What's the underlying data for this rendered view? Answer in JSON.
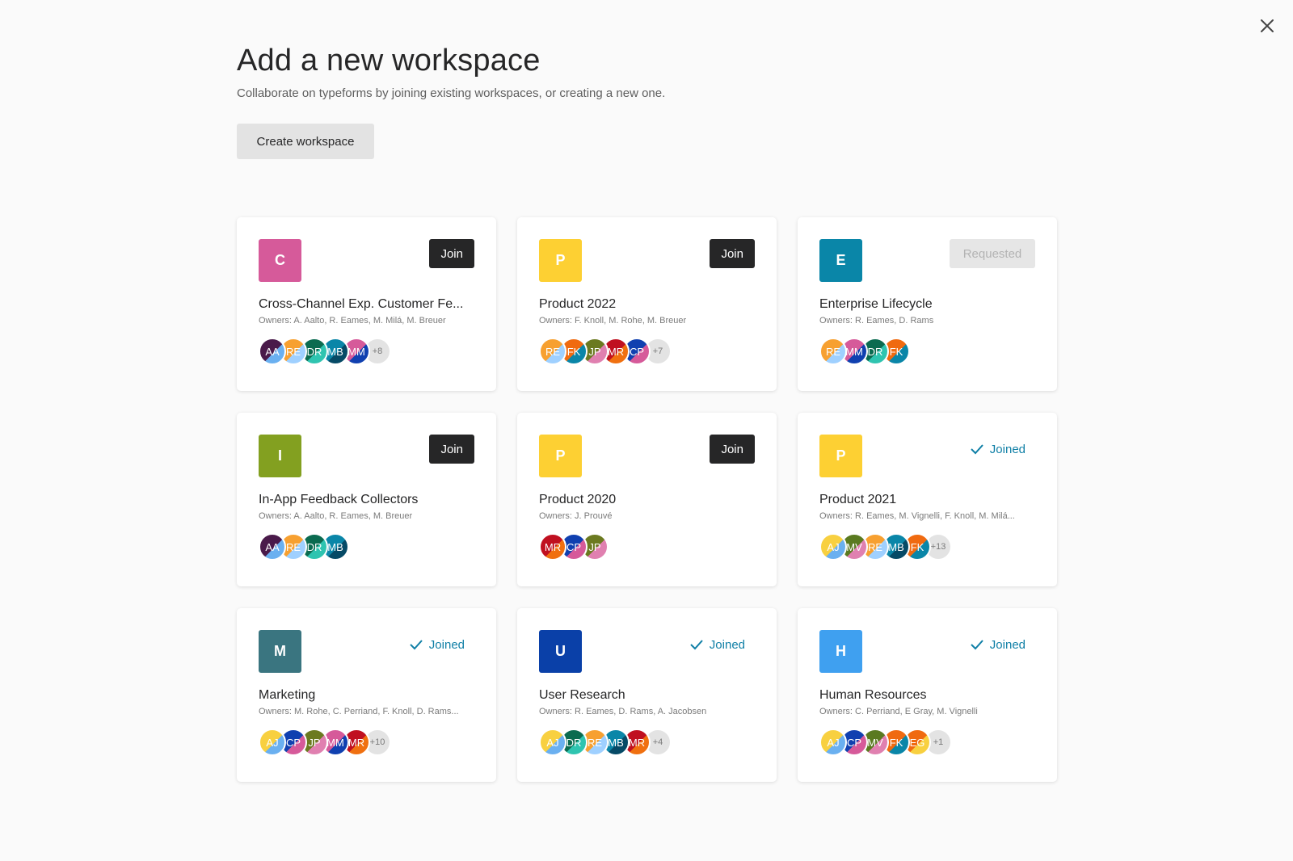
{
  "header": {
    "title": "Add a new workspace",
    "subtitle": "Collaborate on typeforms by joining existing workspaces, or creating a new one.",
    "create_label": "Create workspace"
  },
  "accent": "#0f7fa6",
  "workspaces": [
    {
      "letter": "C",
      "color": "#d65a9a",
      "name": "Cross-Channel Exp. Customer Fe...",
      "owners": "Owners: A. Aalto, R. Eames, M. Milá, M. Breuer",
      "status": "join",
      "status_label": "Join",
      "members": [
        "AA",
        "RE",
        "DR",
        "MB",
        "MM"
      ],
      "more": "+8"
    },
    {
      "letter": "P",
      "color": "#fdd033",
      "name": "Product 2022",
      "owners": "Owners: F. Knoll, M. Rohe, M. Breuer",
      "status": "join",
      "status_label": "Join",
      "members": [
        "RE",
        "FK",
        "JP",
        "MR",
        "CP"
      ],
      "more": "+7"
    },
    {
      "letter": "E",
      "color": "#0a86a8",
      "name": "Enterprise Lifecycle",
      "owners": "Owners: R. Eames, D. Rams",
      "status": "requested",
      "status_label": "Requested",
      "members": [
        "RE",
        "MM",
        "DR",
        "FK"
      ],
      "more": ""
    },
    {
      "letter": "I",
      "color": "#83a020",
      "name": "In-App Feedback Collectors",
      "owners": "Owners: A. Aalto, R. Eames, M. Breuer",
      "status": "join",
      "status_label": "Join",
      "members": [
        "AA",
        "RE",
        "DR",
        "MB"
      ],
      "more": ""
    },
    {
      "letter": "P",
      "color": "#fdd033",
      "name": "Product 2020",
      "owners": "Owners: J. Prouvé",
      "status": "join",
      "status_label": "Join",
      "members": [
        "MR",
        "CP",
        "JP"
      ],
      "more": ""
    },
    {
      "letter": "P",
      "color": "#fdd033",
      "name": "Product 2021",
      "owners": "Owners: R. Eames, M. Vignelli, F. Knoll, M. Milá...",
      "status": "joined",
      "status_label": "Joined",
      "members": [
        "AJ",
        "MV",
        "RE",
        "MB",
        "FK"
      ],
      "more": "+13"
    },
    {
      "letter": "M",
      "color": "#3a7580",
      "name": "Marketing",
      "owners": "Owners: M. Rohe, C. Perriand, F. Knoll, D. Rams...",
      "status": "joined",
      "status_label": "Joined",
      "members": [
        "AJ",
        "CP",
        "JP",
        "MM",
        "MR"
      ],
      "more": "+10"
    },
    {
      "letter": "U",
      "color": "#0a40a8",
      "name": "User Research",
      "owners": "Owners: R. Eames, D. Rams, A. Jacobsen",
      "status": "joined",
      "status_label": "Joined",
      "members": [
        "AJ",
        "DR",
        "RE",
        "MB",
        "MR"
      ],
      "more": "+4"
    },
    {
      "letter": "H",
      "color": "#3fa0f0",
      "name": "Human Resources",
      "owners": "Owners: C. Perriand, E Gray, M. Vignelli",
      "status": "joined",
      "status_label": "Joined",
      "members": [
        "AJ",
        "CP",
        "MV",
        "FK",
        "EG"
      ],
      "more": "+1"
    }
  ],
  "avatar_colors": {
    "AA": [
      "#4a1a4a",
      "#6ab0f0"
    ],
    "RE": [
      "#f7a030",
      "#9fd0ff"
    ],
    "DR": [
      "#0b6b50",
      "#2fc4b0"
    ],
    "MB": [
      "#0a86a8",
      "#064a66"
    ],
    "MM": [
      "#d65a9a",
      "#1040b0"
    ],
    "FK": [
      "#f06a10",
      "#0a86a8"
    ],
    "JP": [
      "#6b7a20",
      "#e080b0"
    ],
    "MR": [
      "#c01020",
      "#f07010"
    ],
    "CP": [
      "#1040b0",
      "#d65a9a"
    ],
    "AJ": [
      "#f8d040",
      "#6ab0f0"
    ],
    "MV": [
      "#5a7a20",
      "#e080b0"
    ],
    "EG": [
      "#f06a10",
      "#f8d040"
    ]
  }
}
